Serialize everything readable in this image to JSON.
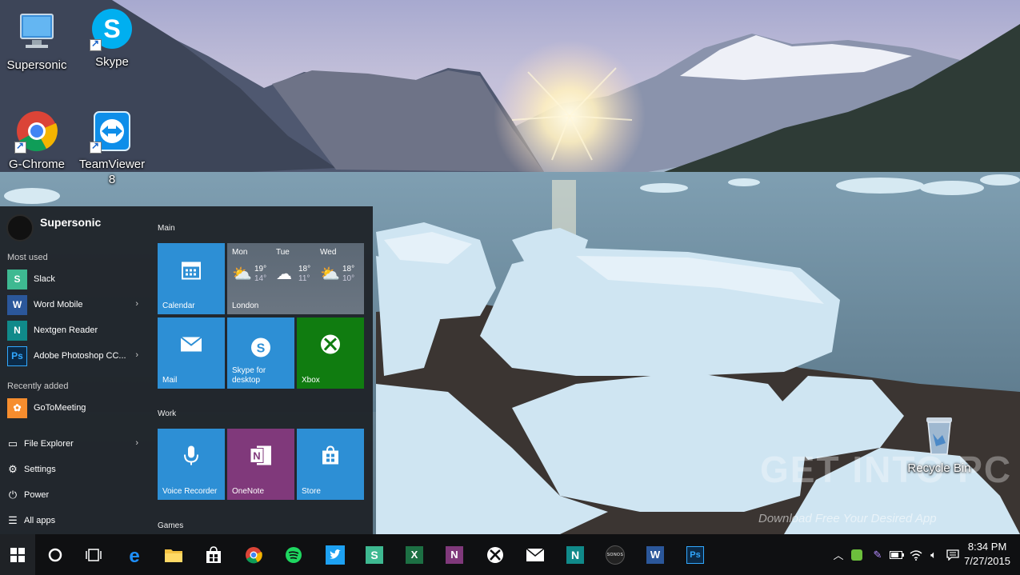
{
  "desktop_icons": [
    {
      "label": "Supersonic",
      "icon": "computer-icon"
    },
    {
      "label": "Skype",
      "icon": "skype-icon"
    },
    {
      "label": "G-Chrome",
      "icon": "chrome-icon"
    },
    {
      "label": "TeamViewer 8",
      "icon": "teamviewer-icon"
    },
    {
      "label": "Recycle Bin",
      "icon": "recycle-bin-icon"
    }
  ],
  "start_menu": {
    "user_name": "Supersonic",
    "most_used_label": "Most used",
    "most_used": [
      {
        "label": "Slack",
        "icon": "slack-icon"
      },
      {
        "label": "Word Mobile",
        "icon": "word-icon"
      },
      {
        "label": "Nextgen Reader",
        "icon": "nextgen-reader-icon"
      },
      {
        "label": "Adobe Photoshop CC...",
        "icon": "photoshop-icon"
      }
    ],
    "recently_added_label": "Recently added",
    "recently_added": [
      {
        "label": "GoToMeeting",
        "icon": "gotomeeting-icon"
      }
    ],
    "system": [
      {
        "label": "File Explorer",
        "icon": "folder-icon"
      },
      {
        "label": "Settings",
        "icon": "gear-icon"
      },
      {
        "label": "Power",
        "icon": "power-icon"
      },
      {
        "label": "All apps",
        "icon": "list-icon"
      }
    ],
    "groups": {
      "main": "Main",
      "work": "Work",
      "games": "Games"
    },
    "tiles": {
      "calendar": "Calendar",
      "mail": "Mail",
      "skype": "Skype for desktop",
      "xbox": "Xbox",
      "voice_recorder": "Voice Recorder",
      "onenote": "OneNote",
      "store": "Store"
    },
    "weather": {
      "location": "London",
      "days": [
        {
          "day": "Mon",
          "high": "19°",
          "low": "14°"
        },
        {
          "day": "Tue",
          "high": "18°",
          "low": "11°"
        },
        {
          "day": "Wed",
          "high": "18°",
          "low": "10°"
        }
      ]
    }
  },
  "watermark": {
    "title": "GET INTO PC",
    "subtitle": "Download Free Your Desired App"
  },
  "taskbar": {
    "time": "8:34 PM",
    "date": "7/27/2015"
  },
  "colors": {
    "tile_blue": "#2d8fd5",
    "tile_green": "#107c10",
    "tile_purple": "#80397b",
    "start_bg": "#1f2328",
    "taskbar_bg": "#0f1012"
  }
}
